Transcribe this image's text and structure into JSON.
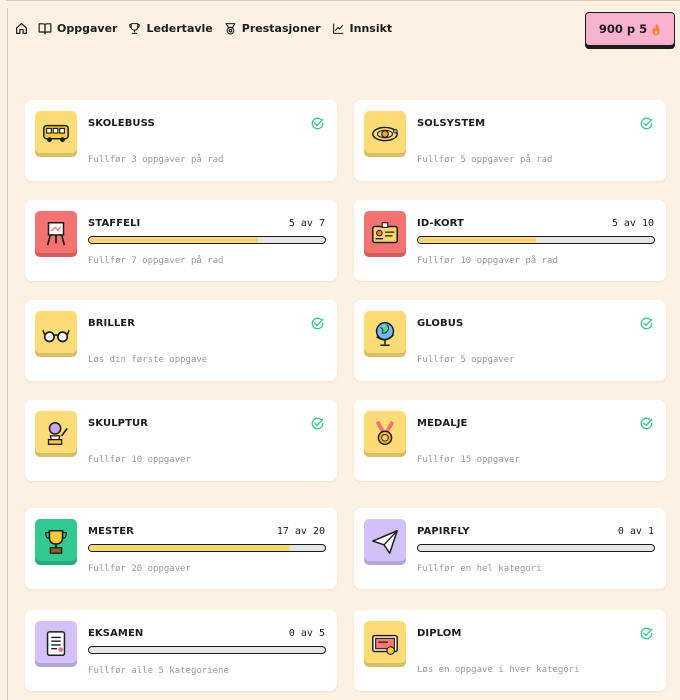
{
  "nav": {
    "home_icon": "home-icon",
    "items": [
      {
        "label": "Oppgaver",
        "icon": "book-icon"
      },
      {
        "label": "Ledertavle",
        "icon": "trophy-icon"
      },
      {
        "label": "Prestasjoner",
        "icon": "award-icon"
      },
      {
        "label": "Innsikt",
        "icon": "chart-line-icon"
      }
    ]
  },
  "score": {
    "points": "900 p",
    "streak": "5",
    "streak_icon": "flame-icon"
  },
  "colors": {
    "background": "#fcf1e3",
    "yellow_tile": "#fddc78",
    "red_tile": "#f47272",
    "green_tile": "#31c98f",
    "purple_tile": "#d3c2f7",
    "progress_fill": "#f7d774",
    "check": "#3cc98f",
    "score_badge": "#f7b2cf"
  },
  "achievements": [
    {
      "title": "SKOLEBUSS",
      "description": "Fullfør 3 oppgaver på rad",
      "completed": true,
      "icon": "school-bus-icon"
    },
    {
      "title": "SOLSYSTEM",
      "description": "Fullfør 5 oppgaver på rad",
      "completed": true,
      "icon": "solar-system-icon"
    },
    {
      "title": "STAFFELI",
      "description": "Fullfør 7 oppgaver på rad",
      "completed": false,
      "progress": "5 av 7",
      "fraction": 0.714,
      "icon": "easel-icon"
    },
    {
      "title": "ID-KORT",
      "description": "Fullfør 10 oppgaver på rad",
      "completed": false,
      "progress": "5 av 10",
      "fraction": 0.5,
      "icon": "id-card-icon"
    },
    {
      "title": "BRILLER",
      "description": "Løs din første oppgave",
      "completed": true,
      "icon": "glasses-icon"
    },
    {
      "title": "GLOBUS",
      "description": "Fullfør 5 oppgaver",
      "completed": true,
      "icon": "globe-icon"
    },
    {
      "title": "SKULPTUR",
      "description": "Fullfør 10 oppgaver",
      "completed": true,
      "icon": "sculpture-icon"
    },
    {
      "title": "MEDALJE",
      "description": "Fullfør 15 oppgaver",
      "completed": true,
      "icon": "medal-icon"
    },
    {
      "title": "MESTER",
      "description": "Fullfør 20 oppgaver",
      "completed": false,
      "progress": "17 av 20",
      "fraction": 0.85,
      "icon": "trophy-cup-icon"
    },
    {
      "title": "PAPIRFLY",
      "description": "Fullfør en hel kategori",
      "completed": false,
      "progress": "0 av 1",
      "fraction": 0,
      "icon": "paper-plane-icon"
    },
    {
      "title": "EKSAMEN",
      "description": "Fullfør alle 5 kategoriene",
      "completed": false,
      "progress": "0 av 5",
      "fraction": 0,
      "icon": "exam-paper-icon"
    },
    {
      "title": "DIPLOM",
      "description": "Løs én oppgave i hver kategori",
      "completed": true,
      "icon": "diploma-icon"
    }
  ]
}
